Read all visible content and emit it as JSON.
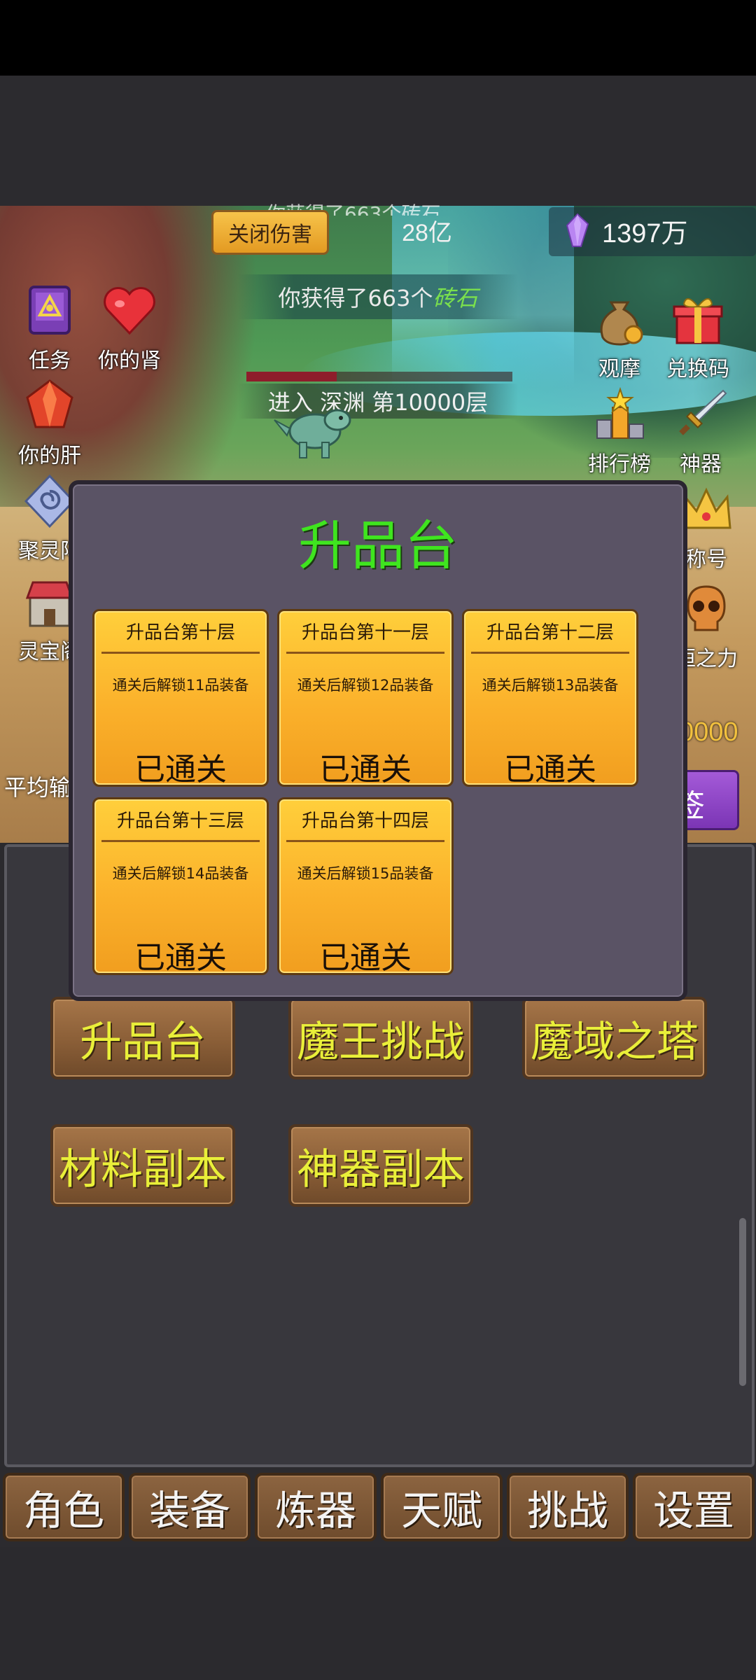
{
  "hud": {
    "close_damage_label": "关闭伤害",
    "gold_value": "28亿",
    "gem_value": "1397万",
    "ghost_message": "你获得了663个砖石"
  },
  "message": {
    "prefix": "你获得了663个",
    "item": "砖石"
  },
  "stage": {
    "text": "进入  深渊  第10000层",
    "hp_fraction": 0.34
  },
  "left_icons": [
    {
      "label": "任务"
    },
    {
      "label": "你的肾"
    },
    {
      "label": "你的肝"
    },
    {
      "label": "聚灵阵"
    },
    {
      "label": "灵宝阁"
    }
  ],
  "right_icons": [
    {
      "label": "观摩"
    },
    {
      "label": "兑换码"
    },
    {
      "label": "排行榜"
    },
    {
      "label": "神器"
    },
    {
      "label": "称号"
    },
    {
      "label": "恒之力"
    }
  ],
  "avg_label": "平均输",
  "right_number": "0000",
  "purple_button_label": "签",
  "modal": {
    "title": "升品台",
    "cards": [
      {
        "title": "升品台第十层",
        "desc": "通关后解锁11品装备",
        "status": "已通关"
      },
      {
        "title": "升品台第十一层",
        "desc": "通关后解锁12品装备",
        "status": "已通关"
      },
      {
        "title": "升品台第十二层",
        "desc": "通关后解锁13品装备",
        "status": "已通关"
      },
      {
        "title": "升品台第十三层",
        "desc": "通关后解锁14品装备",
        "status": "已通关"
      },
      {
        "title": "升品台第十四层",
        "desc": "通关后解锁15品装备",
        "status": "已通关"
      }
    ]
  },
  "dungeon_buttons": [
    {
      "label": "升品台"
    },
    {
      "label": "魔王挑战"
    },
    {
      "label": "魔域之塔"
    },
    {
      "label": "材料副本"
    },
    {
      "label": "神器副本"
    }
  ],
  "nav": [
    {
      "label": "角色"
    },
    {
      "label": "装备"
    },
    {
      "label": "炼器"
    },
    {
      "label": "天赋"
    },
    {
      "label": "挑战"
    },
    {
      "label": "设置"
    }
  ],
  "colors": {
    "title_green": "#3fe51f",
    "card_gold": "#fbb12b",
    "wood": "#8a5e37",
    "button_text_yellow": "#e9ef39",
    "modal_bg": "#5a5365"
  }
}
